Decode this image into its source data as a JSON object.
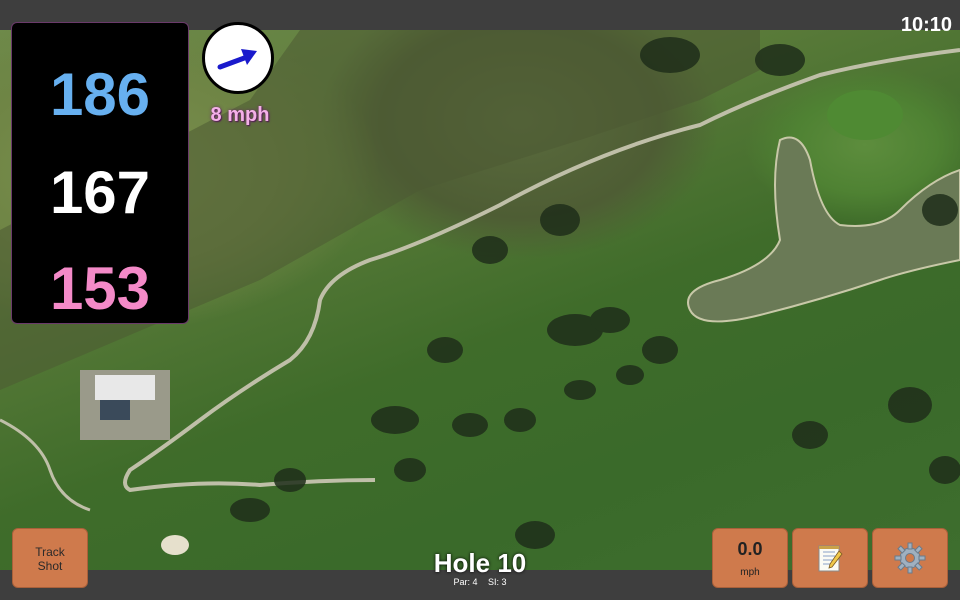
{
  "status": {
    "time": "10:10"
  },
  "yardage": {
    "back": "186",
    "center": "167",
    "front": "153"
  },
  "wind": {
    "speed": "8 mph",
    "direction_icon": "arrow-icon"
  },
  "hole": {
    "title": "Hole 10",
    "par": "Par: 4",
    "si": "SI: 3"
  },
  "buttons": {
    "track_line1": "Track",
    "track_line2": "Shot",
    "speed_value": "0.0",
    "speed_unit": "mph",
    "notes_icon": "notepad-icon",
    "settings_icon": "gear-icon"
  },
  "colors": {
    "back_distance": "#67b0f0",
    "center_distance": "#ffffff",
    "front_distance": "#f48ac8",
    "button_accent": "#cf7a4c"
  }
}
